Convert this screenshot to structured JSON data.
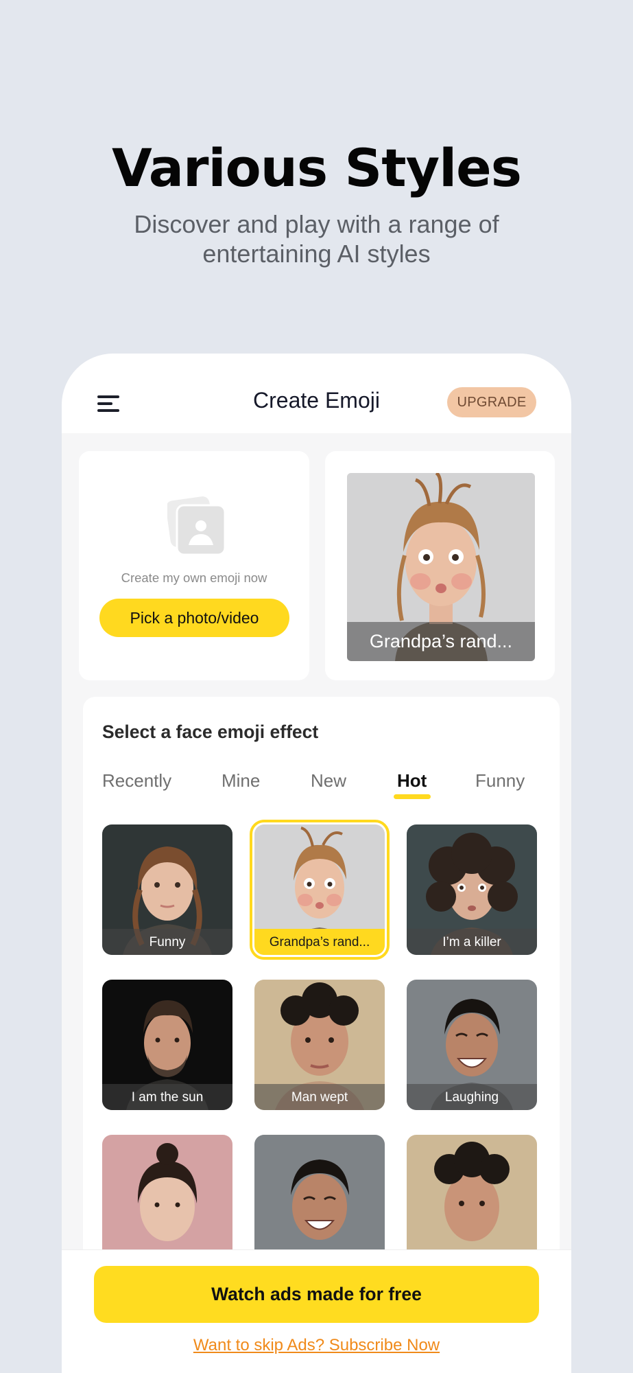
{
  "hero": {
    "title": "Various Styles",
    "subtitle_line1": "Discover and play with a range of",
    "subtitle_line2": "entertaining AI styles"
  },
  "app_bar": {
    "menu_icon": "menu-icon",
    "title": "Create Emoji",
    "upgrade_label": "UPGRADE"
  },
  "create_card": {
    "icon": "photo-gallery-icon",
    "prompt": "Create my own emoji now",
    "button_label": "Pick a photo/video"
  },
  "preview_card": {
    "caption": "Grandpa’s rand..."
  },
  "effects": {
    "title": "Select a face emoji effect",
    "tabs": [
      {
        "label": "Recently"
      },
      {
        "label": "Mine"
      },
      {
        "label": "New"
      },
      {
        "label": "Hot"
      },
      {
        "label": "Funny"
      }
    ],
    "active_tab": "Hot",
    "items": [
      {
        "label": "Funny"
      },
      {
        "label": "Grandpa’s rand..."
      },
      {
        "label": "I’m a killer"
      },
      {
        "label": "I am the sun"
      },
      {
        "label": "Man wept"
      },
      {
        "label": "Laughing"
      },
      {
        "label": ""
      },
      {
        "label": ""
      },
      {
        "label": ""
      }
    ],
    "selected_index": 1
  },
  "footer": {
    "ads_button_label": "Watch ads made for free",
    "skip_link": "Want to skip Ads? Subscribe Now"
  },
  "colors": {
    "accent_yellow": "#ffd91f",
    "upgrade_bg": "#f2c6a4",
    "link_orange": "#f08a1a",
    "page_bg": "#e3e7ee"
  }
}
